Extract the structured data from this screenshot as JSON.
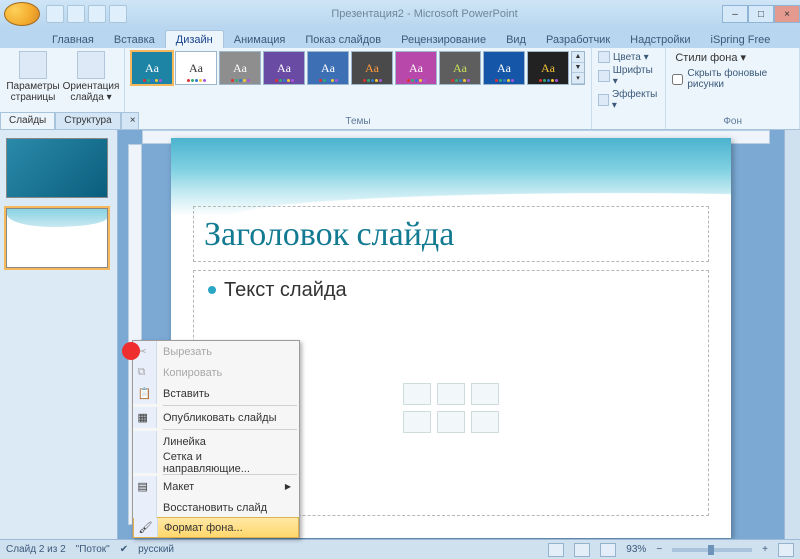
{
  "window": {
    "title": "Презентация2 - Microsoft PowerPoint"
  },
  "tabs": {
    "items": [
      "Главная",
      "Вставка",
      "Дизайн",
      "Анимация",
      "Показ слайдов",
      "Рецензирование",
      "Вид",
      "Разработчик",
      "Надстройки",
      "iSpring Free"
    ],
    "active": "Дизайн"
  },
  "ribbon": {
    "page_setup": {
      "params": "Параметры\nстраницы",
      "orient": "Ориентация\nслайда ▾",
      "label": "Параметры страницы"
    },
    "themes_label": "Темы",
    "theme_thumbs": [
      {
        "bg": "#1d84a6",
        "fg": "#ffffff",
        "selected": true
      },
      {
        "bg": "#ffffff",
        "fg": "#333333"
      },
      {
        "bg": "#8e8e8e",
        "fg": "#ffffff"
      },
      {
        "bg": "#6a4ba4",
        "fg": "#ffffff"
      },
      {
        "bg": "#3d6fb5",
        "fg": "#ffffff"
      },
      {
        "bg": "#4a4a4a",
        "fg": "#ff9a3d"
      },
      {
        "bg": "#b848a9",
        "fg": "#ffffff"
      },
      {
        "bg": "#5e5e5e",
        "fg": "#c7e25b"
      },
      {
        "bg": "#1556a8",
        "fg": "#ffffff"
      },
      {
        "bg": "#222222",
        "fg": "#f0c235"
      }
    ],
    "theme_opts": {
      "colors": "Цвета ▾",
      "fonts": "Шрифты ▾",
      "effects": "Эффекты ▾"
    },
    "bg": {
      "styles": "Стили фона ▾",
      "hide": "Скрыть фоновые рисунки",
      "label": "Фон"
    }
  },
  "side_tabs": {
    "slides": "Слайды",
    "outline": "Структура",
    "close": "×"
  },
  "slide": {
    "title_placeholder": "Заголовок слайда",
    "body_placeholder": "Текст слайда"
  },
  "context_menu": {
    "cut": "Вырезать",
    "copy": "Копировать",
    "paste": "Вставить",
    "publish": "Опубликовать слайды",
    "ruler": "Линейка",
    "grid": "Сетка и направляющие...",
    "layout": "Макет",
    "reset": "Восстановить слайд",
    "format_bg": "Формат фона..."
  },
  "status": {
    "slide_info": "Слайд 2 из 2",
    "theme": "\"Поток\"",
    "lang": "русский",
    "zoom": "93%"
  }
}
